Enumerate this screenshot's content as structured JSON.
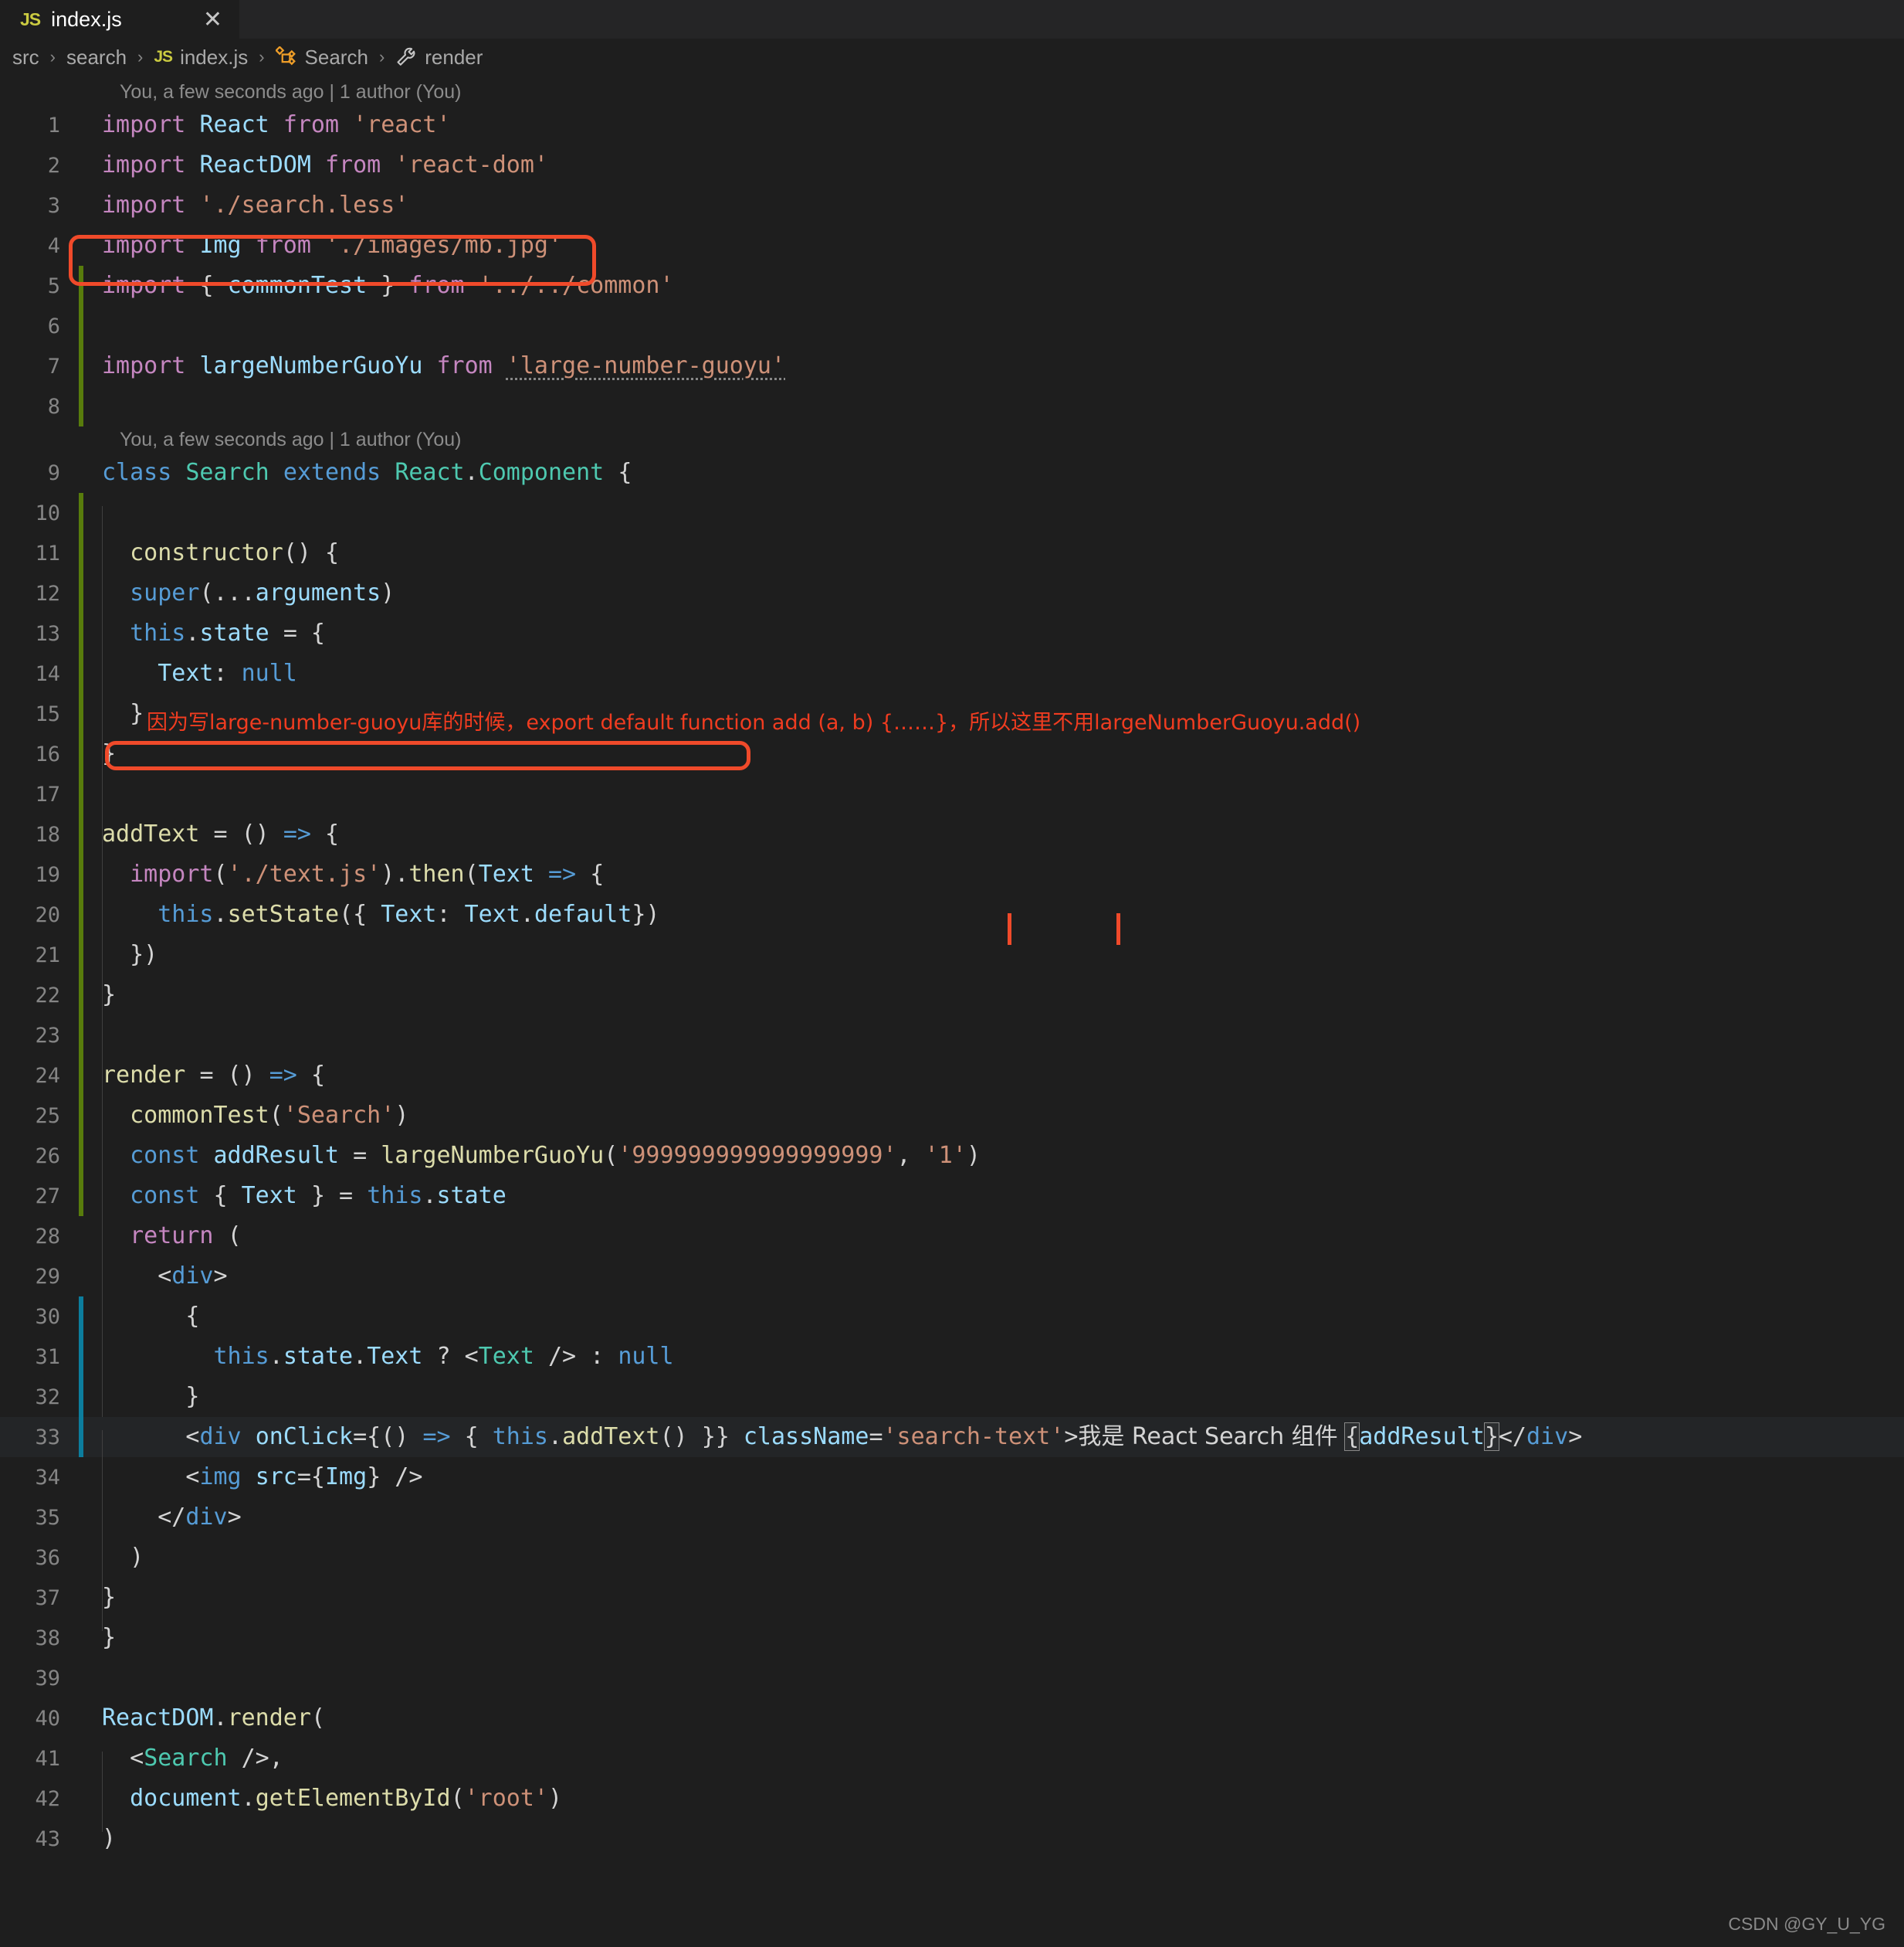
{
  "window": {
    "tab": {
      "icon": "js-file-icon",
      "label": "index.js",
      "close": "✕"
    }
  },
  "breadcrumb": {
    "items": [
      {
        "label": "src",
        "icon": ""
      },
      {
        "label": "search",
        "icon": ""
      },
      {
        "label": "index.js",
        "icon": "js-file-icon"
      },
      {
        "label": "Search",
        "icon": "class-symbol-icon"
      },
      {
        "label": "render",
        "icon": "method-symbol-icon"
      }
    ],
    "separator": "›"
  },
  "blame": {
    "first": "You, a few seconds ago | 1 author (You)",
    "second": "You, a few seconds ago | 1 author (You)"
  },
  "annotations": {
    "note_line25": "因为写large-number-guoyu库的时候，export default function add (a, b) {……}，所以这里不用largeNumberGuoyu.add()",
    "highlight_color": "#f04a2a"
  },
  "watermark": "CSDN @GY_U_YG",
  "code": {
    "lines": [
      {
        "n": "1",
        "change": "none"
      },
      {
        "n": "2",
        "change": "none"
      },
      {
        "n": "3",
        "change": "none"
      },
      {
        "n": "4",
        "change": "none"
      },
      {
        "n": "5",
        "change": "green"
      },
      {
        "n": "6",
        "change": "green"
      },
      {
        "n": "7",
        "change": "green"
      },
      {
        "n": "8",
        "change": "green"
      },
      {
        "n": "9",
        "change": "none"
      },
      {
        "n": "10",
        "change": "green"
      },
      {
        "n": "11",
        "change": "green"
      },
      {
        "n": "12",
        "change": "green"
      },
      {
        "n": "13",
        "change": "green"
      },
      {
        "n": "14",
        "change": "green"
      },
      {
        "n": "15",
        "change": "green"
      },
      {
        "n": "16",
        "change": "green"
      },
      {
        "n": "17",
        "change": "green"
      },
      {
        "n": "18",
        "change": "green"
      },
      {
        "n": "19",
        "change": "green"
      },
      {
        "n": "20",
        "change": "green"
      },
      {
        "n": "21",
        "change": "green"
      },
      {
        "n": "22",
        "change": "green"
      },
      {
        "n": "23",
        "change": "green"
      },
      {
        "n": "24",
        "change": "green"
      },
      {
        "n": "25",
        "change": "green"
      },
      {
        "n": "26",
        "change": "green"
      },
      {
        "n": "27",
        "change": "green"
      },
      {
        "n": "28",
        "change": "none"
      },
      {
        "n": "29",
        "change": "none"
      },
      {
        "n": "30",
        "change": "blue"
      },
      {
        "n": "31",
        "change": "blue"
      },
      {
        "n": "32",
        "change": "blue"
      },
      {
        "n": "33",
        "change": "blue"
      },
      {
        "n": "34",
        "change": "none"
      },
      {
        "n": "35",
        "change": "none"
      },
      {
        "n": "36",
        "change": "none"
      },
      {
        "n": "37",
        "change": "none"
      },
      {
        "n": "38",
        "change": "none"
      },
      {
        "n": "39",
        "change": "none"
      },
      {
        "n": "40",
        "change": "none"
      },
      {
        "n": "41",
        "change": "none"
      },
      {
        "n": "42",
        "change": "none"
      },
      {
        "n": "43",
        "change": "none"
      }
    ],
    "text": {
      "l1": "import React from 'react'",
      "l2": "import ReactDOM from 'react-dom'",
      "l3": "import './search.less'",
      "l4": "import Img from './images/mb.jpg'",
      "l5": "import { commonTest } from '../../common'",
      "l6": "",
      "l7": "import largeNumberGuoYu from 'large-number-guoyu'",
      "l8": "",
      "l9": "class Search extends React.Component {",
      "l10": "",
      "l11": "  constructor() {",
      "l12": "  super(...arguments)",
      "l13": "  this.state = {",
      "l14": "    Text: null",
      "l15": "  }",
      "l16": "}",
      "l17": "",
      "l18": "addText = () => {",
      "l19": "  import('./text.js').then(Text => {",
      "l20": "    this.setState({ Text: Text.default})",
      "l21": "  })",
      "l22": "}",
      "l23": "",
      "l24": "render = () => {",
      "l25": "  commonTest('Search')",
      "l26": "  const addResult = largeNumberGuoYu('999999999999999999', '1')",
      "l27": "  const { Text } = this.state",
      "l28": "  return (",
      "l29": "    <div>",
      "l30": "      {",
      "l31": "        this.state.Text ? <Text /> : null",
      "l32": "      }",
      "l33": "      <div onClick={() => { this.addText() }} className='search-text'>我是 React Search 组件 {addResult}</div>",
      "l34": "      <img src={Img} />",
      "l35": "    </div>",
      "l36": "  )",
      "l37": "}",
      "l38": "}",
      "l39": "",
      "l40": "ReactDOM.render(",
      "l41": "  <Search />,",
      "l42": "  document.getElementById('root')",
      "l43": ")"
    }
  }
}
